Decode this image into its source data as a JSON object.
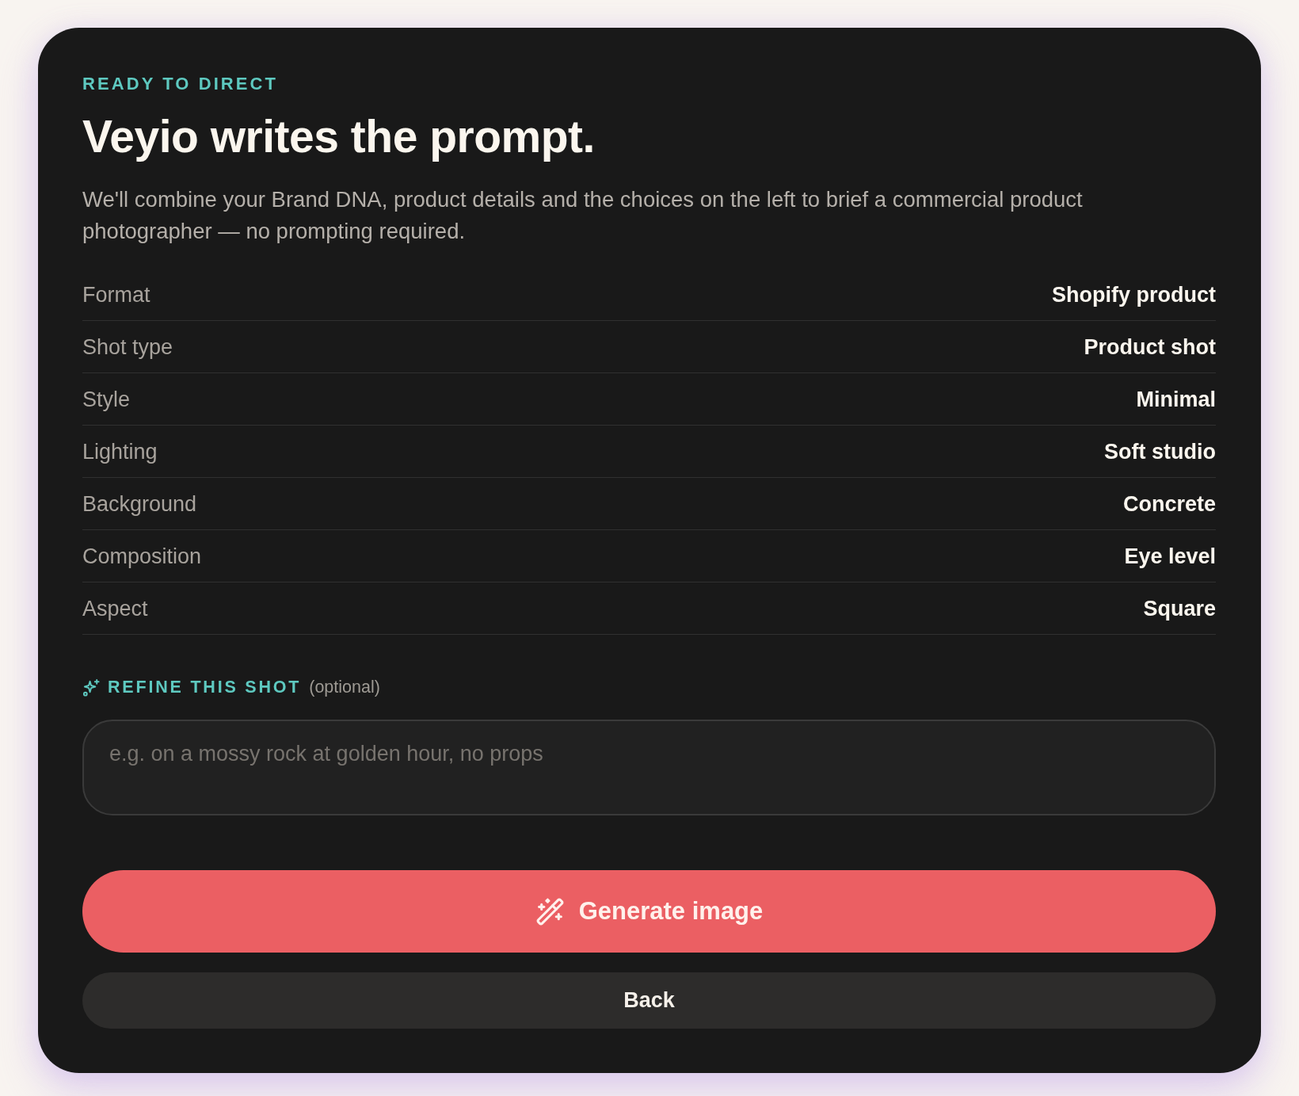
{
  "eyebrow": "READY TO DIRECT",
  "title": "Veyio writes the prompt.",
  "description": "We'll combine your Brand DNA, product details and the choices on the left to brief a commercial product photographer — no prompting required.",
  "summary": [
    {
      "label": "Format",
      "value": "Shopify product"
    },
    {
      "label": "Shot type",
      "value": "Product shot"
    },
    {
      "label": "Style",
      "value": "Minimal"
    },
    {
      "label": "Lighting",
      "value": "Soft studio"
    },
    {
      "label": "Background",
      "value": "Concrete"
    },
    {
      "label": "Composition",
      "value": "Eye level"
    },
    {
      "label": "Aspect",
      "value": "Square"
    }
  ],
  "refine": {
    "label": "REFINE THIS SHOT",
    "hint": "(optional)",
    "placeholder": "e.g. on a mossy rock at golden hour, no props"
  },
  "buttons": [
    {
      "kind": "primary",
      "label": "Generate image"
    },
    {
      "kind": "secondary",
      "label": "Back"
    }
  ]
}
